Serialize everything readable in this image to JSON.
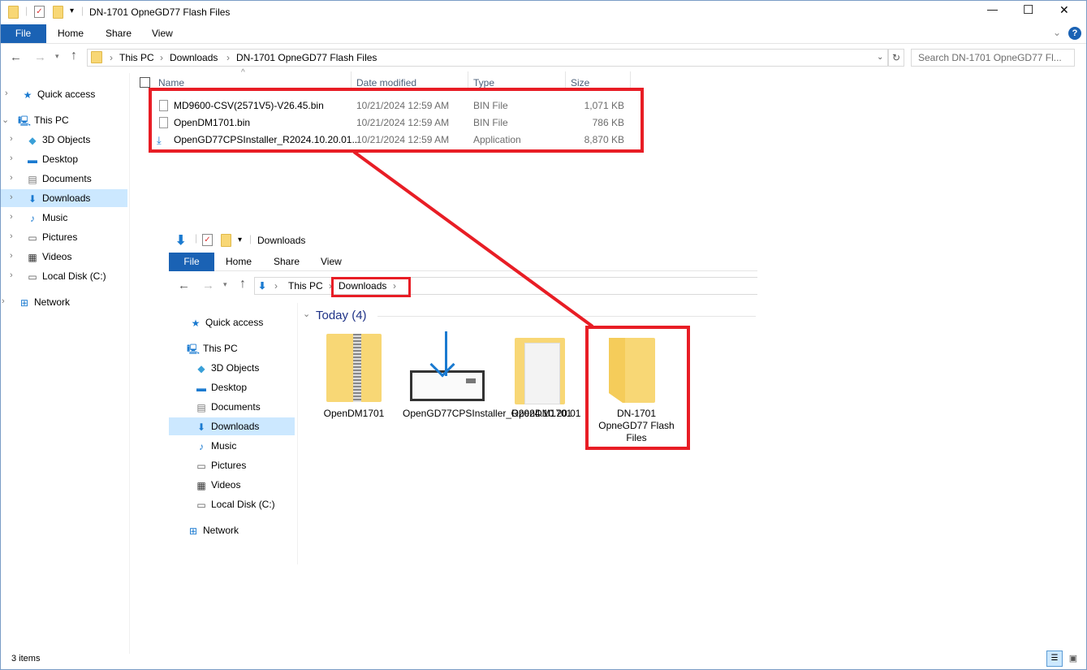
{
  "window": {
    "title": "DN-1701 OpneGD77 Flash Files",
    "minimize": "—",
    "maximize": "☐",
    "close": "✕",
    "help": "?",
    "collapse": "⌄"
  },
  "ribbon": {
    "tabs": [
      "File",
      "Home",
      "Share",
      "View"
    ]
  },
  "address": {
    "crumbs": [
      "This PC",
      "Downloads",
      "DN-1701 OpneGD77 Flash Files"
    ],
    "search_placeholder": "Search DN-1701 OpneGD77 Fl..."
  },
  "nav": [
    {
      "label": "Quick access",
      "icon": "star-icon"
    },
    {
      "label": "This PC",
      "icon": "computer-icon"
    },
    {
      "label": "3D Objects",
      "icon": "cube-icon"
    },
    {
      "label": "Desktop",
      "icon": "desktop-icon"
    },
    {
      "label": "Documents",
      "icon": "document-icon"
    },
    {
      "label": "Downloads",
      "icon": "download-icon"
    },
    {
      "label": "Music",
      "icon": "music-icon"
    },
    {
      "label": "Pictures",
      "icon": "picture-icon"
    },
    {
      "label": "Videos",
      "icon": "video-icon"
    },
    {
      "label": "Local Disk (C:)",
      "icon": "drive-icon"
    },
    {
      "label": "Network",
      "icon": "network-icon"
    }
  ],
  "columns": {
    "name": "Name",
    "date": "Date modified",
    "type": "Type",
    "size": "Size"
  },
  "files": [
    {
      "name": "MD9600-CSV(2571V5)-V26.45.bin",
      "date": "10/21/2024 12:59 AM",
      "type": "BIN File",
      "size": "1,071 KB"
    },
    {
      "name": "OpenDM1701.bin",
      "date": "10/21/2024 12:59 AM",
      "type": "BIN File",
      "size": "786 KB"
    },
    {
      "name": "OpenGD77CPSInstaller_R2024.10.20.01...",
      "date": "10/21/2024 12:59 AM",
      "type": "Application",
      "size": "8,870 KB"
    }
  ],
  "status": {
    "items": "3 items"
  },
  "inset": {
    "title": "Downloads",
    "tabs": [
      "File",
      "Home",
      "Share",
      "View"
    ],
    "crumbs": [
      "This PC",
      "Downloads"
    ],
    "group": "Today (4)",
    "items": [
      {
        "label": "OpenDM1701",
        "icon": "zip-folder-icon"
      },
      {
        "label": "OpenGD77CPSInstaller_R2024.10.20.01",
        "icon": "installer-icon"
      },
      {
        "label": "OpenDM1701",
        "icon": "folder-with-files-icon"
      },
      {
        "label": "DN-1701 OpneGD77 Flash Files",
        "icon": "folder-icon"
      }
    ]
  },
  "accent": "#1a62b4",
  "highlight": "#e81d25"
}
